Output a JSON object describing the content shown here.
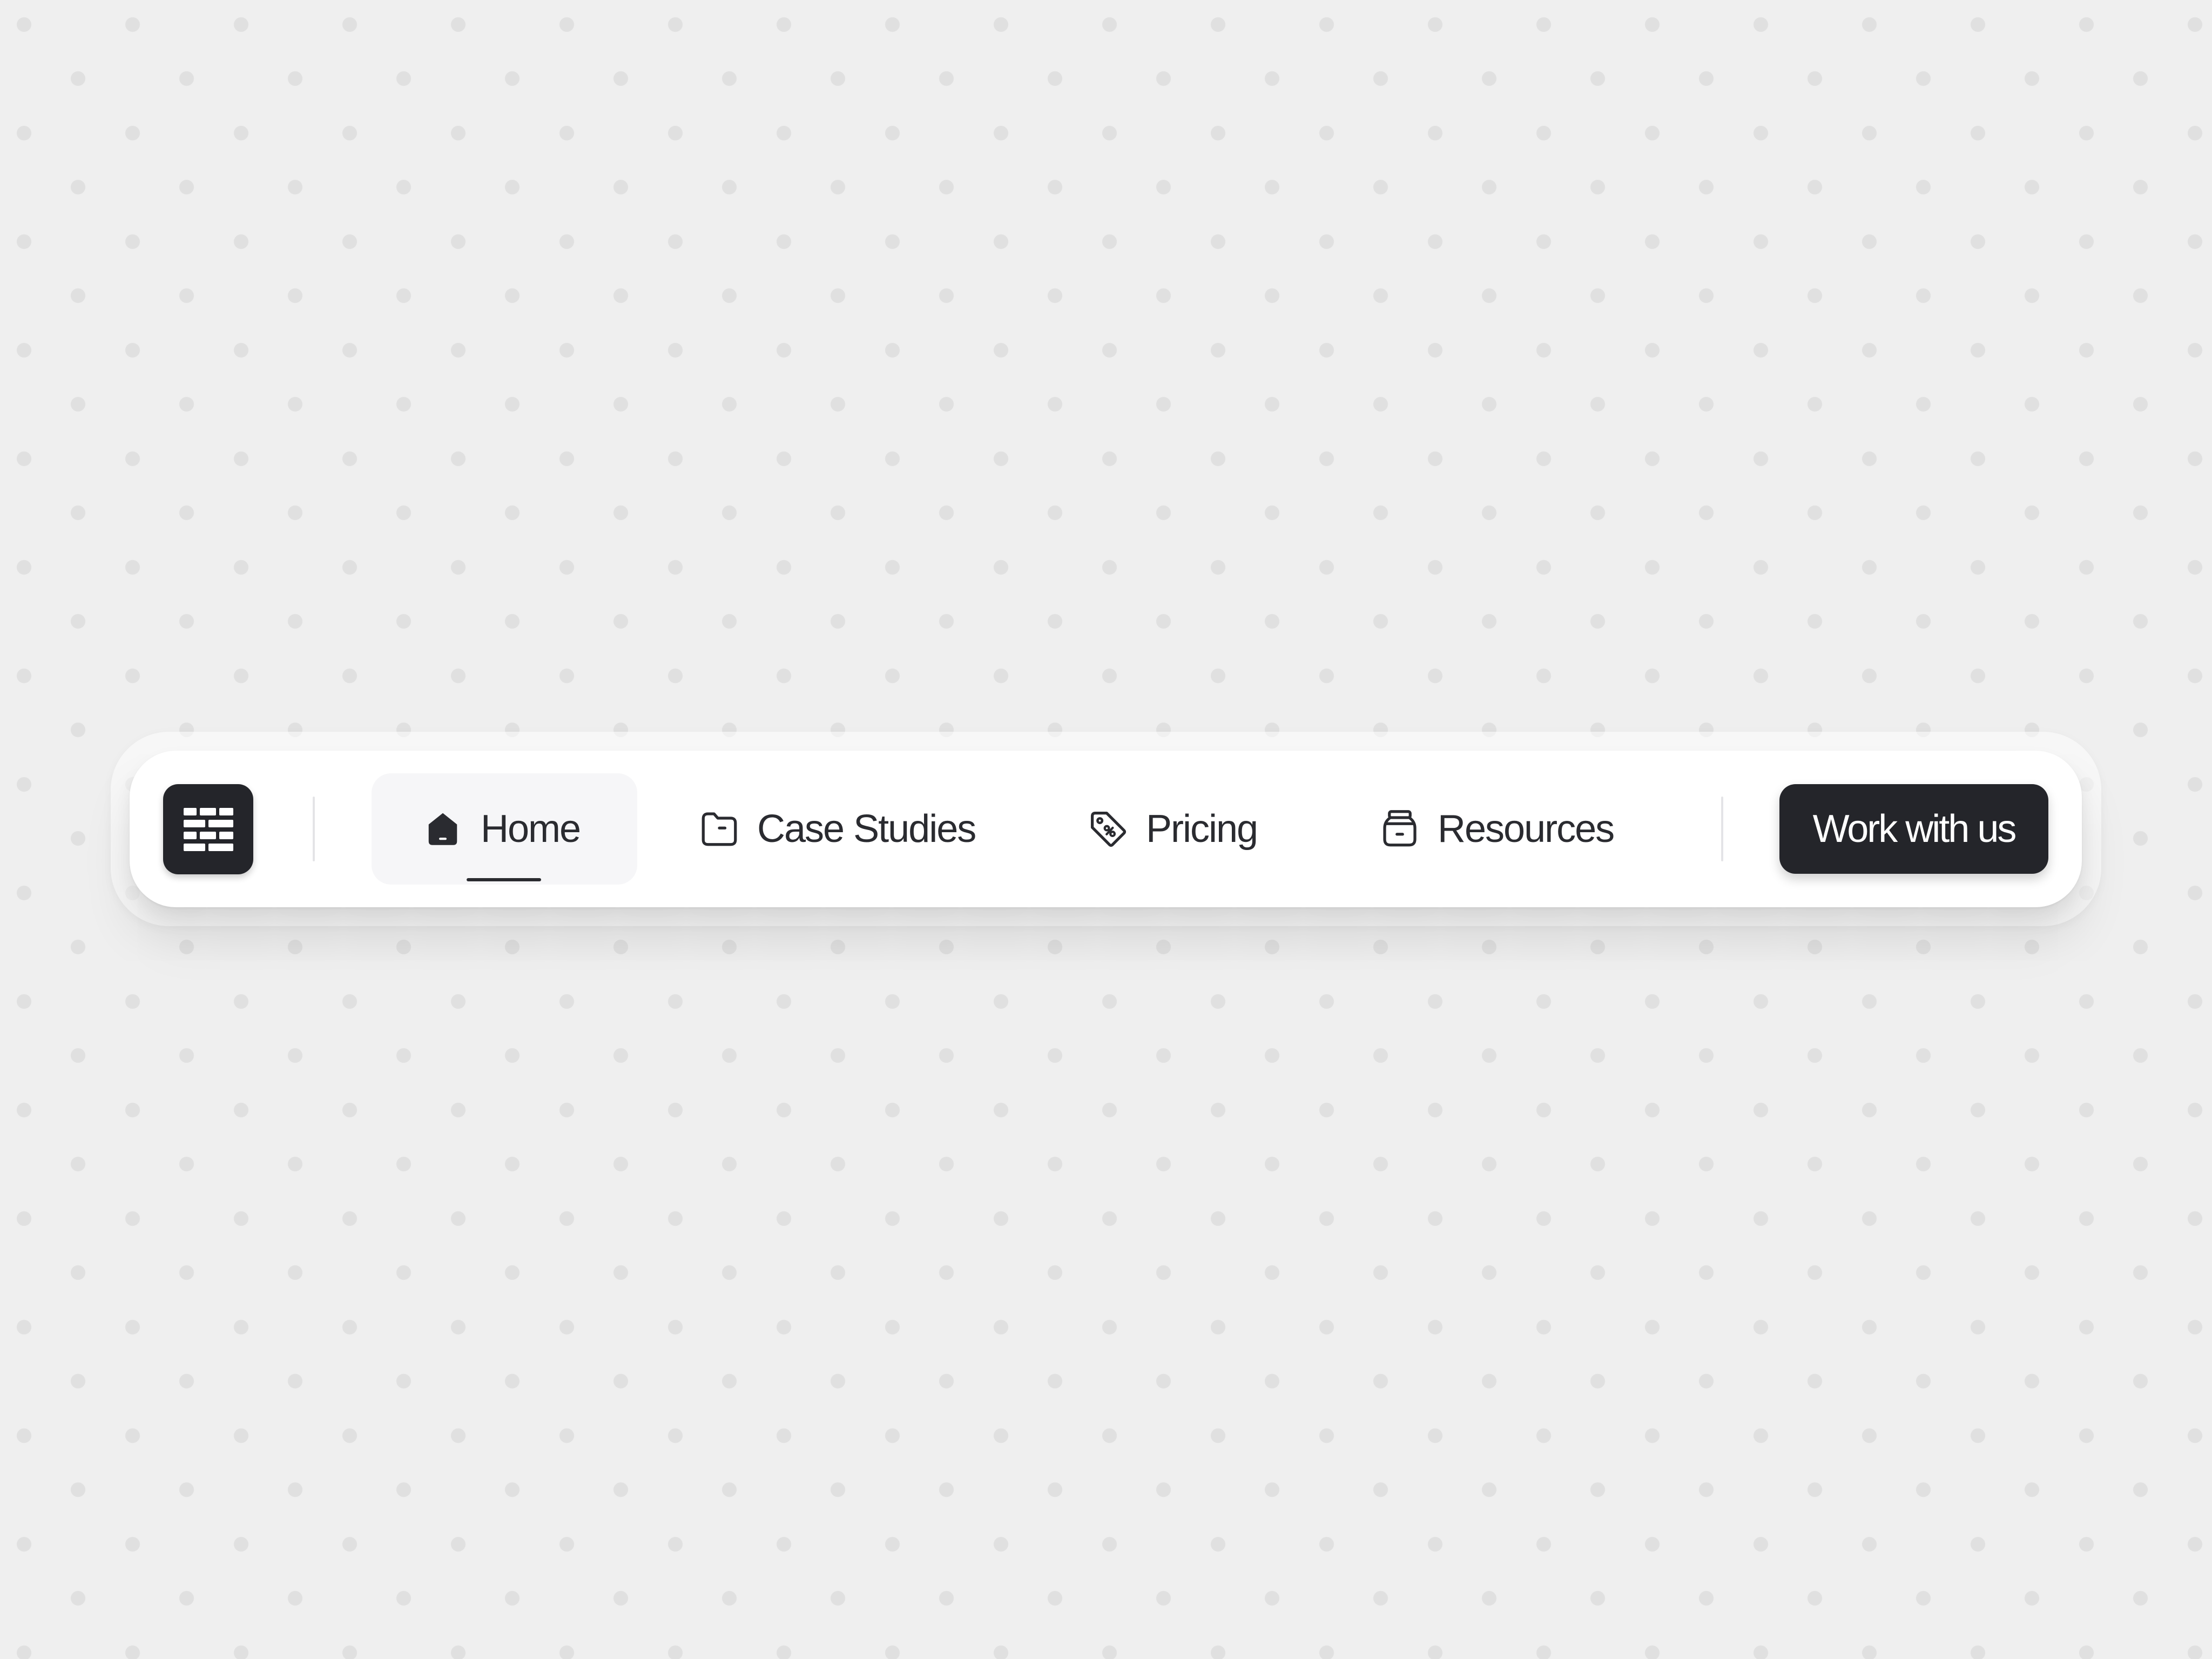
{
  "nav": {
    "logo_icon": "brick-wall-icon",
    "items": [
      {
        "label": "Home",
        "icon": "home-icon",
        "active": true
      },
      {
        "label": "Case Studies",
        "icon": "folder-icon",
        "active": false
      },
      {
        "label": "Pricing",
        "icon": "price-tag-icon",
        "active": false
      },
      {
        "label": "Resources",
        "icon": "jar-icon",
        "active": false
      }
    ],
    "cta_label": "Work with us"
  },
  "colors": {
    "background": "#efefef",
    "background_dots": "#e0e0e0",
    "bar": "#ffffff",
    "dark": "#24252a",
    "text": "#2a2b30",
    "active_item_bg": "#f6f6f8"
  }
}
